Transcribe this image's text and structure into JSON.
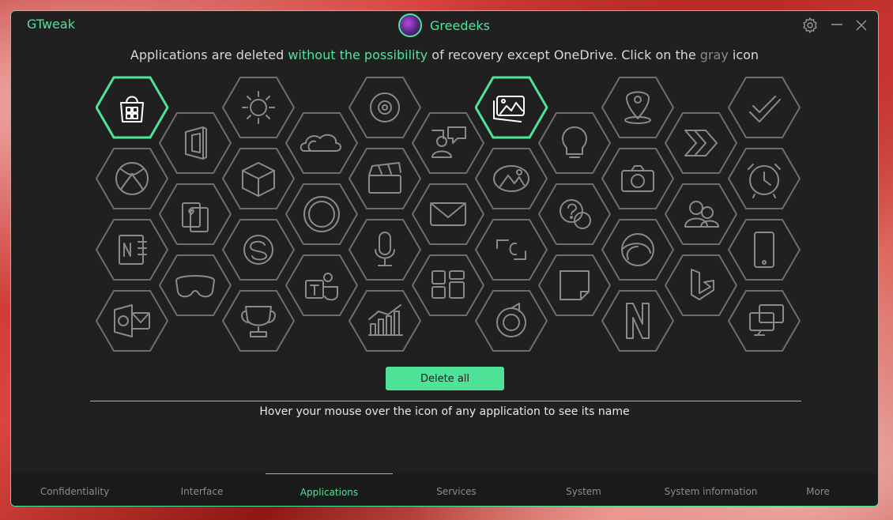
{
  "app": {
    "title": "GTweak",
    "username": "Greedeks"
  },
  "notice": {
    "part1": "Applications are deleted ",
    "highlight": "without the possibility",
    "part2": " of recovery except OneDrive. Click on the ",
    "gray_word": "gray",
    "part3": " icon"
  },
  "apps": [
    {
      "icon": "store-icon",
      "active": true
    },
    {
      "icon": "office-icon",
      "active": false
    },
    {
      "icon": "weather-icon",
      "active": false
    },
    {
      "icon": "onedrive-icon",
      "active": false
    },
    {
      "icon": "groove-music-icon",
      "active": false
    },
    {
      "icon": "people-icon",
      "active": false
    },
    {
      "icon": "photos-icon",
      "active": true
    },
    {
      "icon": "tips-icon",
      "active": false
    },
    {
      "icon": "maps-icon",
      "active": false
    },
    {
      "icon": "power-automate-icon",
      "active": false
    },
    {
      "icon": "todo-icon",
      "active": false
    },
    {
      "icon": "xbox-icon",
      "active": false
    },
    {
      "icon": "solitaire-icon",
      "active": false
    },
    {
      "icon": "3d-viewer-icon",
      "active": false
    },
    {
      "icon": "cortana-icon",
      "active": false
    },
    {
      "icon": "movies-tv-icon",
      "active": false
    },
    {
      "icon": "mail-icon",
      "active": false
    },
    {
      "icon": "paint-3d-icon",
      "active": false
    },
    {
      "icon": "get-help-icon",
      "active": false
    },
    {
      "icon": "camera-icon",
      "active": false
    },
    {
      "icon": "family-icon",
      "active": false
    },
    {
      "icon": "alarms-icon",
      "active": false
    },
    {
      "icon": "onenote-icon",
      "active": false
    },
    {
      "icon": "mixed-reality-icon",
      "active": false
    },
    {
      "icon": "skype-icon",
      "active": false
    },
    {
      "icon": "teams-icon",
      "active": false
    },
    {
      "icon": "voice-recorder-icon",
      "active": false
    },
    {
      "icon": "widgets-icon",
      "active": false
    },
    {
      "icon": "clipchamp-icon",
      "active": false
    },
    {
      "icon": "sticky-notes-icon",
      "active": false
    },
    {
      "icon": "edge-icon",
      "active": false
    },
    {
      "icon": "bing-icon",
      "active": false
    },
    {
      "icon": "phone-link-icon",
      "active": false
    },
    {
      "icon": "outlook-icon",
      "active": false
    },
    {
      "icon": "solitaire-trophy-icon",
      "active": false
    },
    {
      "icon": "finance-icon",
      "active": false
    },
    {
      "icon": "media-player-icon",
      "active": false
    },
    {
      "icon": "netflix-icon",
      "active": false
    },
    {
      "icon": "remote-desktop-icon",
      "active": false
    }
  ],
  "delete_all_label": "Delete all",
  "hover_hint": "Hover your mouse over the icon of any application to see its name",
  "tabs": [
    {
      "label": "Confidentiality"
    },
    {
      "label": "Interface"
    },
    {
      "label": "Applications"
    },
    {
      "label": "Services"
    },
    {
      "label": "System"
    },
    {
      "label": "System information"
    },
    {
      "label": "More"
    }
  ],
  "active_tab": "Applications",
  "colors": {
    "accent": "#4fe39a",
    "background": "#202020",
    "inactive_icon": "#8a8a8a"
  }
}
